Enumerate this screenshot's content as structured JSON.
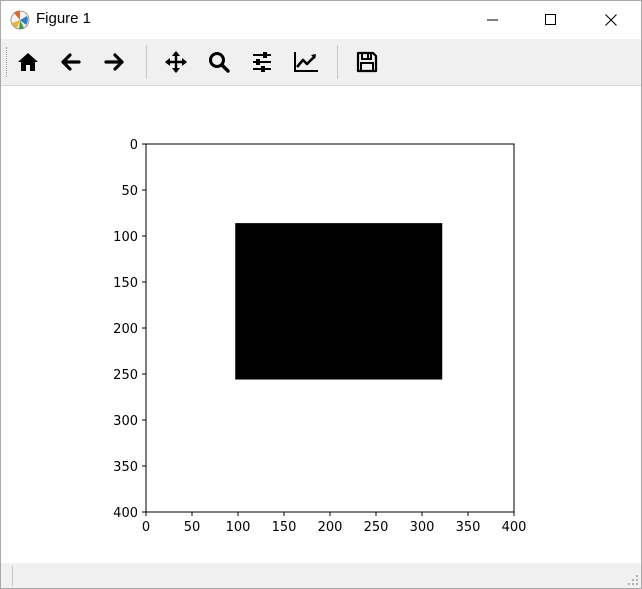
{
  "window": {
    "title": "Figure 1"
  },
  "toolbar": {
    "buttons": [
      {
        "name": "home",
        "icon": "home-icon"
      },
      {
        "name": "back",
        "icon": "arrow-left-icon"
      },
      {
        "name": "forward",
        "icon": "arrow-right-icon"
      },
      {
        "name": "pan",
        "icon": "move-icon"
      },
      {
        "name": "zoom",
        "icon": "magnifier-icon"
      },
      {
        "name": "subplots",
        "icon": "sliders-icon"
      },
      {
        "name": "customize",
        "icon": "line-chart-icon"
      },
      {
        "name": "save",
        "icon": "floppy-disk-icon"
      }
    ]
  },
  "chart_data": {
    "type": "heatmap",
    "description_kind": "image",
    "x_ticks": [
      0,
      50,
      100,
      150,
      200,
      250,
      300,
      350,
      400
    ],
    "y_ticks": [
      0,
      50,
      100,
      150,
      200,
      250,
      300,
      350,
      400
    ],
    "x_tick_labels": [
      "0",
      "50",
      "100",
      "150",
      "200",
      "250",
      "300",
      "350",
      "400"
    ],
    "y_tick_labels": [
      "0",
      "50",
      "100",
      "150",
      "200",
      "250",
      "300",
      "350",
      "400"
    ],
    "xlim": [
      0,
      400
    ],
    "ylim": [
      400,
      0
    ],
    "y_inverted": true,
    "background_color": "#ffffff",
    "regions": [
      {
        "x0": 97,
        "x1": 322,
        "y0": 86,
        "y1": 256,
        "color": "#000000"
      }
    ],
    "grid": false,
    "title": "",
    "xlabel": "",
    "ylabel": ""
  }
}
